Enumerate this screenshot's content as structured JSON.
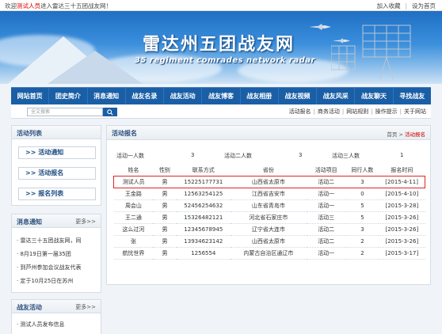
{
  "topbar": {
    "welcome_prefix": "欢迎",
    "user": "测试人员",
    "welcome_suffix": "进入雷达三十五团战友网！",
    "favorite": "加入收藏",
    "homepage": "设为首页",
    "separator": "|"
  },
  "banner": {
    "title": "雷达州五团战友网",
    "subtitle": "35 regiment comrades network radar"
  },
  "nav": {
    "items": [
      "网站首页",
      "团史简介",
      "消息通知",
      "战友名录",
      "战友活动",
      "战友博客",
      "战友相册",
      "战友视频",
      "战友风采",
      "战友聊天",
      "寻找战友"
    ]
  },
  "search": {
    "placeholder": "全文搜索",
    "sublinks": [
      "活动报名",
      "商务活动",
      "网站规则",
      "操作提示",
      "关于网站"
    ],
    "separator": "|"
  },
  "sidebar": {
    "activity_title": "活动列表",
    "activity_items": [
      ">> 活动通知",
      ">> 活动报名",
      ">> 报名列表"
    ],
    "news_title": "消息通知",
    "news_more": "更多>>",
    "news_items": [
      "雷达三十五团战友网，同",
      "8月19日第一届35团",
      "到芦州参加会议战友代表",
      "定于10月25日在苏州"
    ],
    "comrade_title": "战友活动",
    "comrade_more": "更多>>",
    "comrade_items": [
      "测试人员发布信息"
    ]
  },
  "main": {
    "title": "活动报名",
    "breadcrumb_home": "首页",
    "breadcrumb_sep": ">",
    "breadcrumb_current": "活动报名",
    "summary": [
      {
        "label": "活动一人数",
        "value": "3"
      },
      {
        "label": "活动二人数",
        "value": "3"
      },
      {
        "label": "活动三人数",
        "value": "1"
      }
    ],
    "table": {
      "headers": [
        "姓名",
        "性别",
        "联系方式",
        "省份",
        "活动项目",
        "同行人数",
        "报名时间"
      ],
      "rows": [
        [
          "测试人员",
          "男",
          "15225177731",
          "山西省太原市",
          "活动二",
          "3",
          "[2015-4-11]"
        ],
        [
          "王金路",
          "男",
          "12563254125",
          "江西省吉安市",
          "活动一",
          "0",
          "[2015-4-10]"
        ],
        [
          "周会山",
          "男",
          "52456254632",
          "山东省青岛市",
          "活动一",
          "5",
          "[2015-3-28]"
        ],
        [
          "王二通",
          "男",
          "15326482121",
          "河北省石家庄市",
          "活动三",
          "5",
          "[2015-3-26]"
        ],
        [
          "这么过河",
          "男",
          "12345678945",
          "辽宁省大连市",
          "活动二",
          "3",
          "[2015-3-26]"
        ],
        [
          "张",
          "男",
          "13934623142",
          "山西省太原市",
          "活动二",
          "2",
          "[2015-3-26]"
        ],
        [
          "航忧世界",
          "男",
          "1256554",
          "内蒙古自治区通辽市",
          "活动一",
          "2",
          "[2015-3-17]"
        ]
      ],
      "highlighted_row": 0
    }
  },
  "colors": {
    "nav_bg": "#1a5fa6",
    "highlight_border": "#e02424",
    "accent_red": "#cc0000"
  }
}
